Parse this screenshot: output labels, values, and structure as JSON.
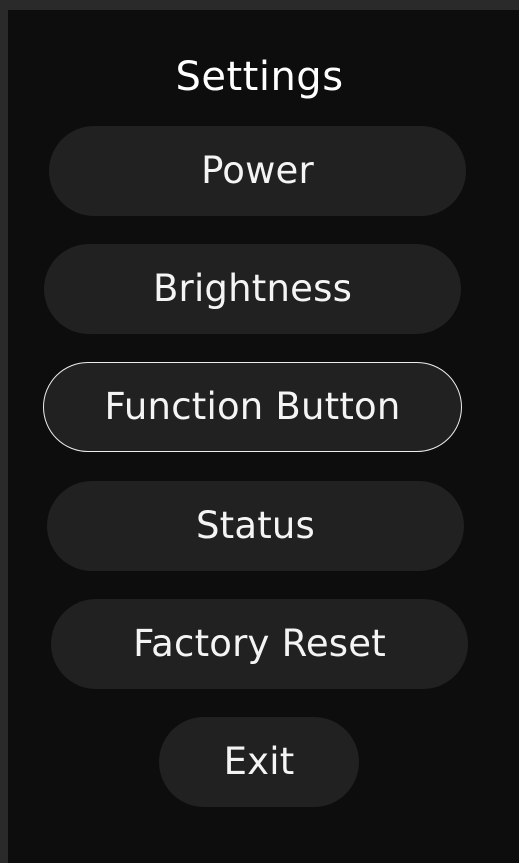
{
  "title": "Settings",
  "menu": {
    "items": [
      {
        "label": "Power",
        "selected": false
      },
      {
        "label": "Brightness",
        "selected": false
      },
      {
        "label": "Function Button",
        "selected": true
      },
      {
        "label": "Status",
        "selected": false
      },
      {
        "label": "Factory Reset",
        "selected": false
      }
    ],
    "exit_label": "Exit"
  },
  "colors": {
    "outer_background": "#2a2a2a",
    "panel_background": "#0d0d0d",
    "button_background": "#212121",
    "selected_border": "#ededed",
    "text": "#f4f4f4"
  }
}
